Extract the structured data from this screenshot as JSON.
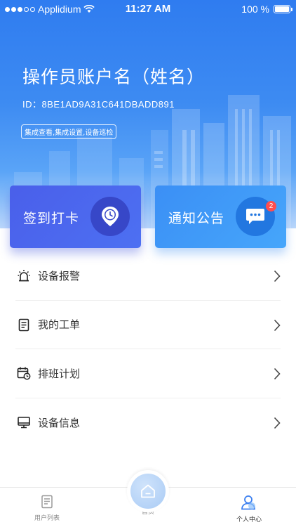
{
  "status_bar": {
    "carrier": "Applidium",
    "time": "11:27 AM",
    "battery": "100 %"
  },
  "account": {
    "name": "操作员账户名（姓名）",
    "id_label": "ID：8BE1AD9A31C641DBADD891",
    "tag": "集成查看,集成设置,设备巡检"
  },
  "cards": {
    "checkin_label": "签到打卡",
    "notice_label": "通知公告",
    "notice_badge": "2"
  },
  "menu": {
    "items": [
      {
        "label": "设备报警",
        "icon": "alarm-icon"
      },
      {
        "label": "我的工单",
        "icon": "clipboard-icon"
      },
      {
        "label": "排班计划",
        "icon": "calendar-clock-icon"
      },
      {
        "label": "设备信息",
        "icon": "monitor-icon"
      }
    ]
  },
  "tabbar": {
    "users": "用户列表",
    "home": "首页",
    "profile": "个人中心"
  },
  "colors": {
    "header_blue": "#2f7cf0",
    "checkin_card": "#4a5fea",
    "notice_card": "#3b8ff5",
    "badge_red": "#ff4d4f"
  }
}
